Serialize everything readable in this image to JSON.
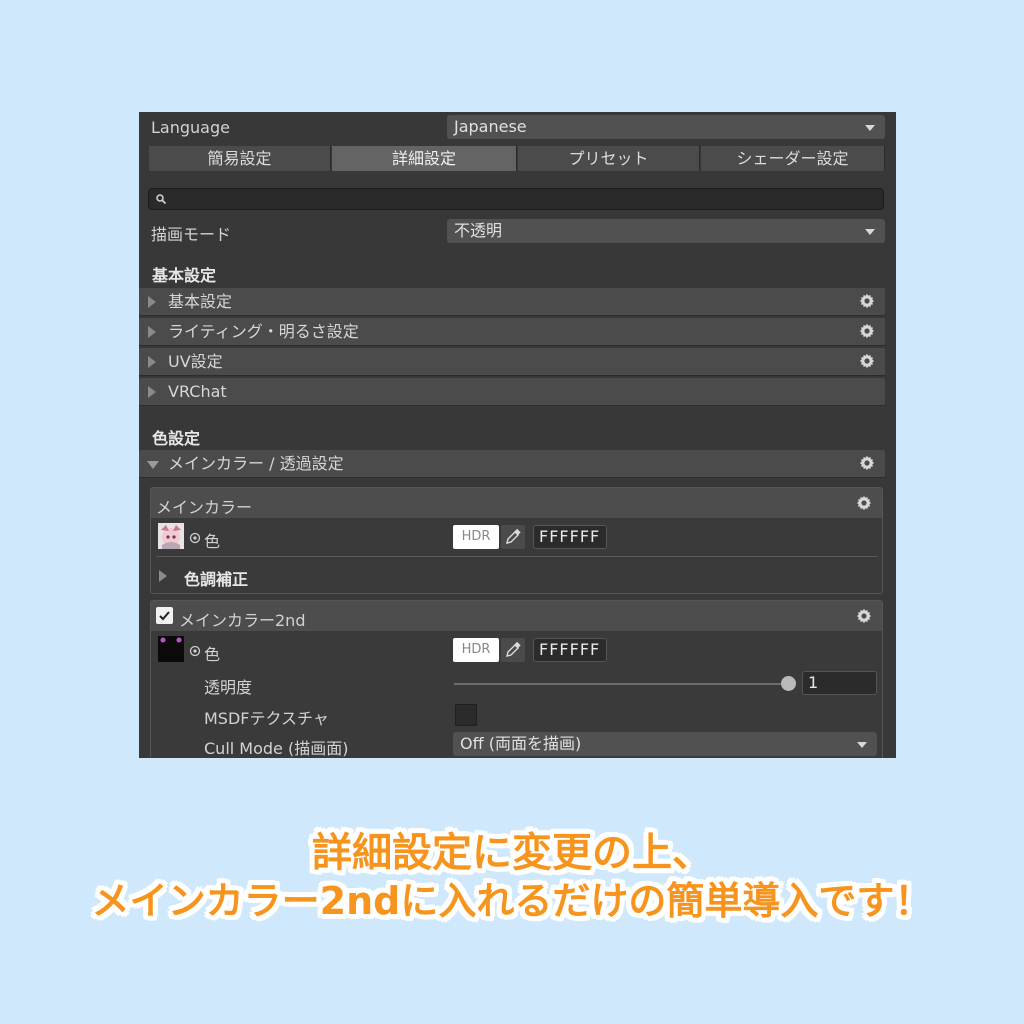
{
  "language": {
    "label": "Language",
    "value": "Japanese"
  },
  "tabs": [
    {
      "label": "簡易設定",
      "active": false
    },
    {
      "label": "詳細設定",
      "active": true
    },
    {
      "label": "プリセット",
      "active": false
    },
    {
      "label": "シェーダー設定",
      "active": false
    }
  ],
  "search": {
    "placeholder": ""
  },
  "render_mode": {
    "label": "描画モード",
    "value": "不透明"
  },
  "sections": {
    "basic": {
      "title": "基本設定",
      "items": [
        "基本設定",
        "ライティング・明るさ設定",
        "UV設定",
        "VRChat"
      ]
    },
    "color": {
      "title": "色設定",
      "fold_label": "メインカラー / 透過設定"
    }
  },
  "main_color": {
    "title": "メインカラー",
    "color_label": "色",
    "hdr": "HDR",
    "hex": "FFFFFF",
    "tone_label": "色調補正"
  },
  "main_color_2nd": {
    "title": "メインカラー2nd",
    "checked": true,
    "color_label": "色",
    "hdr": "HDR",
    "hex": "FFFFFF",
    "opacity_label": "透明度",
    "opacity_value": "1",
    "opacity": 1,
    "msdf_label": "MSDFテクスチャ",
    "cull_label": "Cull Mode (描画面)",
    "cull_value": "Off (両面を描画)"
  },
  "caption": {
    "line1": "詳細設定に変更の上、",
    "line2": "メインカラー2ndに入れるだけの簡単導入です！"
  },
  "colors": {
    "background": "#cfe8fb",
    "panel": "#383838",
    "caption": "#f7941d"
  }
}
